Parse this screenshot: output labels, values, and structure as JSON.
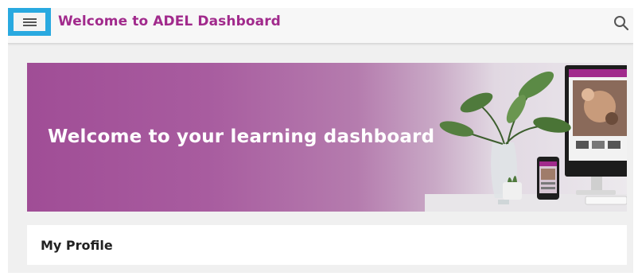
{
  "header": {
    "title": "Welcome to ADEL Dashboard",
    "menu_icon": "hamburger-menu-icon",
    "search_icon": "search-icon"
  },
  "banner": {
    "heading": "Welcome to your learning dashboard"
  },
  "profile": {
    "title": "My Profile"
  },
  "colors": {
    "brand": "#a12a8c",
    "menu_highlight": "#29a9e0",
    "banner_purple": "#a04d96"
  }
}
